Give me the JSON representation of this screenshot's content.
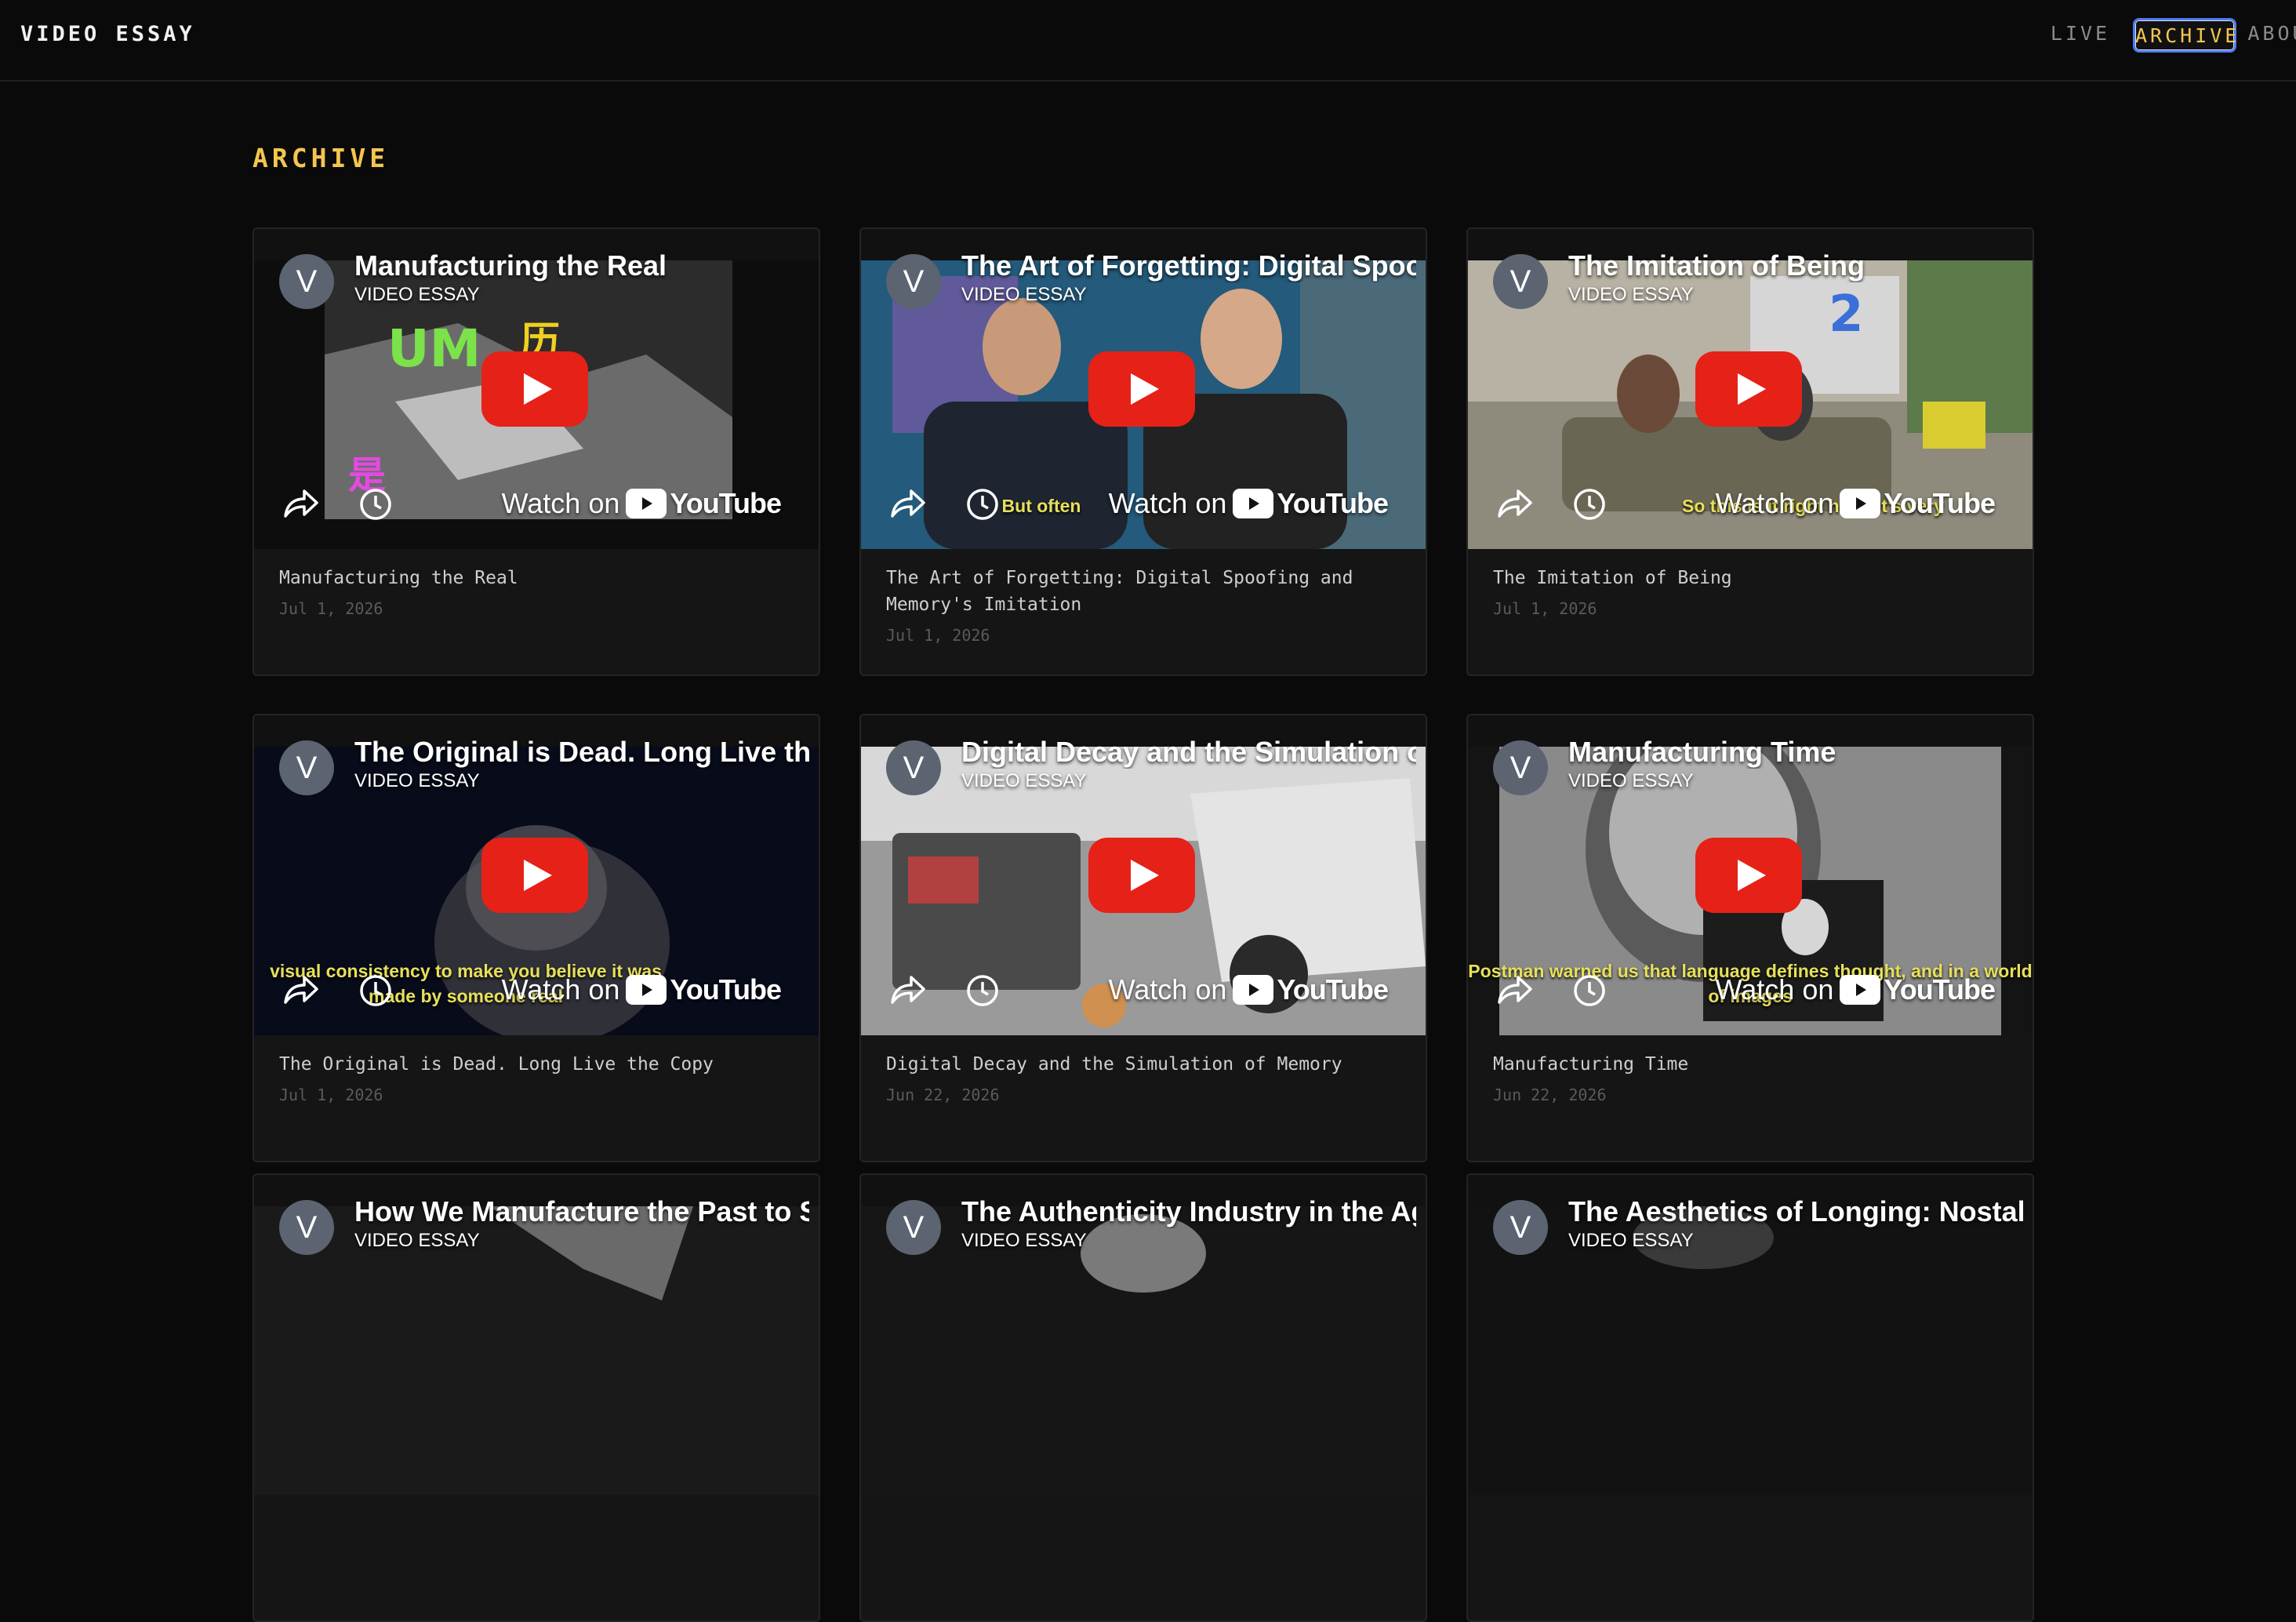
{
  "header": {
    "brand": "VIDEO ESSAY",
    "nav": [
      "LIVE",
      "ARCHIVE",
      "ABOUT"
    ]
  },
  "section_title": "ARCHIVE",
  "common": {
    "avatar_letter": "V",
    "channel": "VIDEO ESSAY",
    "watch_on": "Watch on",
    "youtube": "YouTube"
  },
  "cards": [
    {
      "video_title": "Manufacturing the Real",
      "title": "Manufacturing the Real",
      "date": "Jul 1, 2026",
      "caption": ""
    },
    {
      "video_title": "The Art of Forgetting: Digital Spoofi",
      "title": "The Art of Forgetting: Digital Spoofing and Memory's Imitation",
      "date": "Jul 1, 2026",
      "caption": "But often"
    },
    {
      "video_title": "The Imitation of Being",
      "title": "The Imitation of Being",
      "date": "Jul 1, 2026",
      "caption": "So this is it right here, it's very"
    },
    {
      "video_title": "The Original is Dead. Long Live the",
      "title": "The Original is Dead. Long Live the Copy",
      "date": "Jul 1, 2026",
      "caption": "visual consistency to make you believe it was made by someone real"
    },
    {
      "video_title": "Digital Decay and the Simulation of",
      "title": "Digital Decay and the Simulation of Memory",
      "date": "Jun 22, 2026",
      "caption": ""
    },
    {
      "video_title": "Manufacturing Time",
      "title": "Manufacturing Time",
      "date": "Jun 22, 2026",
      "caption": "Postman warned us that language defines thought, and in a world of images"
    },
    {
      "video_title": "How We Manufacture the Past to S",
      "title": "",
      "date": "",
      "caption": ""
    },
    {
      "video_title": "The Authenticity Industry in the Age",
      "title": "",
      "date": "",
      "caption": ""
    },
    {
      "video_title": "The Aesthetics of Longing: Nostalg",
      "title": "",
      "date": "",
      "caption": ""
    }
  ]
}
